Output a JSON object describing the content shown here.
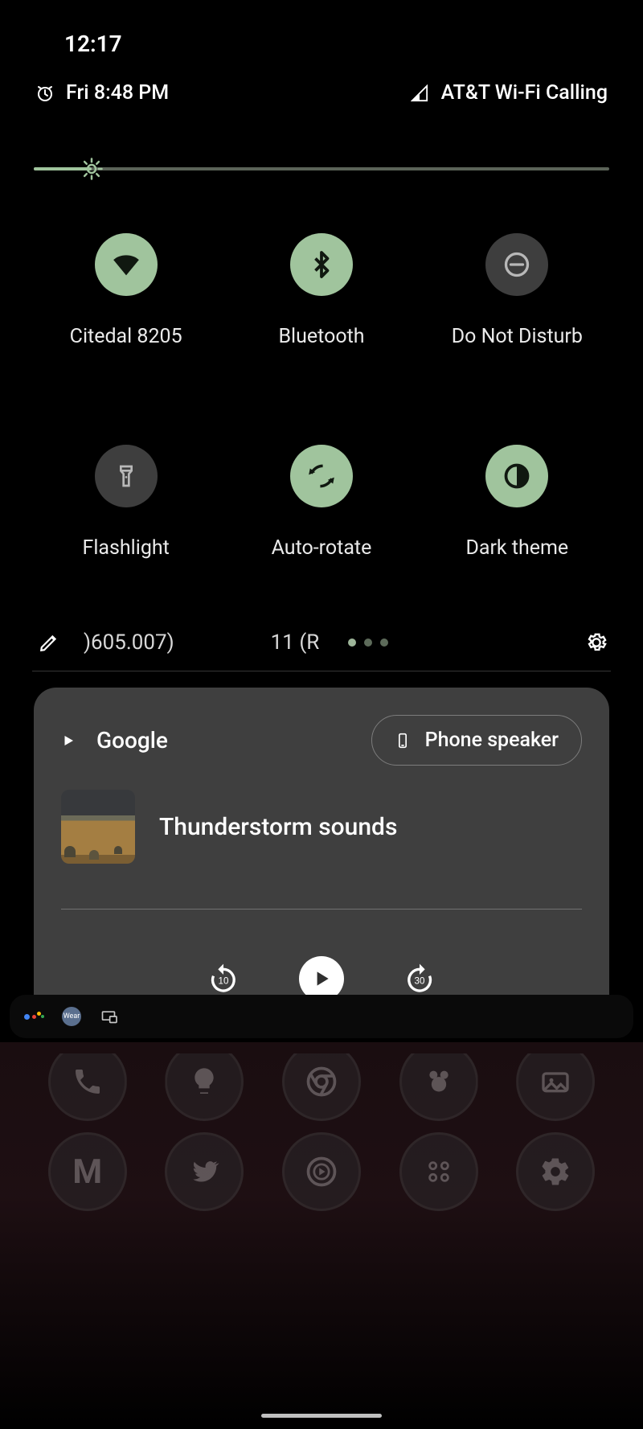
{
  "status_bar": {
    "time": "12:17"
  },
  "qs_header": {
    "alarm_label": "Fri 8:48 PM",
    "carrier": "AT&T Wi-Fi Calling"
  },
  "brightness": {
    "percent": 10
  },
  "tiles": [
    {
      "name": "wifi",
      "label": "Citedal 8205",
      "active": true
    },
    {
      "name": "bluetooth",
      "label": "Bluetooth",
      "active": true
    },
    {
      "name": "dnd",
      "label": "Do Not Disturb",
      "active": false
    },
    {
      "name": "flashlight",
      "label": "Flashlight",
      "active": false
    },
    {
      "name": "autorotate",
      "label": "Auto-rotate",
      "active": true
    },
    {
      "name": "darktheme",
      "label": "Dark theme",
      "active": true
    }
  ],
  "build": {
    "left": ")605.007)",
    "right": "11 (R"
  },
  "media": {
    "app": "Google",
    "output": "Phone speaker",
    "title": "Thunderstorm sounds",
    "rewind_seconds": "10",
    "forward_seconds": "30"
  },
  "tray": {
    "wear_label": "Wear"
  },
  "colors": {
    "tile_on": "#a0c49d",
    "tile_off": "#3e3e3e",
    "card": "#3f3f3f"
  }
}
